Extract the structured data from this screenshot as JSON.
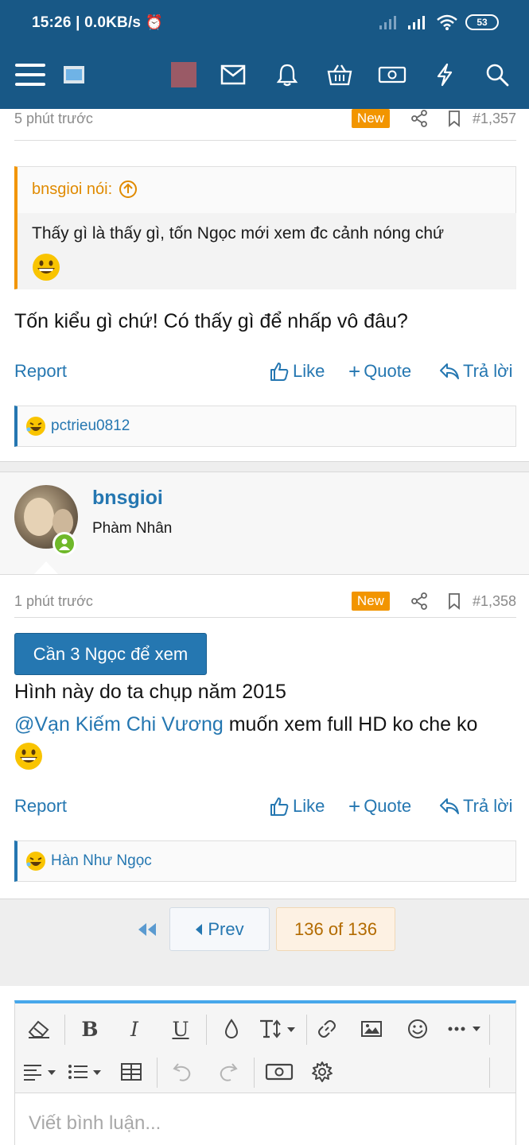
{
  "status_bar": {
    "time": "15:26",
    "network": "0.0KB/s",
    "battery": "53"
  },
  "colors": {
    "header_bg": "#185886",
    "accent": "#2577b1",
    "new_badge": "#f29500",
    "online": "#6fb82a"
  },
  "nav_icons": [
    "menu-icon",
    "logo-icon",
    "avatar-icon",
    "inbox-icon",
    "bell-icon",
    "basket-icon",
    "money-icon",
    "flash-icon",
    "search-icon"
  ],
  "post1": {
    "time": "5 phút trước",
    "badge": "New",
    "number": "#1,357",
    "quote_author": "bnsgioi nói:",
    "quote_text": "Thấy gì là thấy gì, tốn Ngọc mới xem đc cảnh nóng chứ",
    "body": "Tốn kiểu gì chứ! Có thấy gì để nhấp vô đâu?",
    "report": "Report",
    "like": "Like",
    "quote": "Quote",
    "reply": "Trả lời",
    "reaction_user": "pctrieu0812"
  },
  "post2": {
    "author": "bnsgioi",
    "author_title": "Phàm Nhân",
    "time": "1 phút trước",
    "badge": "New",
    "number": "#1,358",
    "unlock_button": "Cần 3 Ngọc để xem",
    "line1": "Hình này do ta chụp năm 2015",
    "mention": "@Vạn Kiếm Chi Vương",
    "line2_rest": " muốn xem full HD ko che ko",
    "report": "Report",
    "like": "Like",
    "quote": "Quote",
    "reply": "Trả lời",
    "reaction_user": "Hàn Như Ngọc"
  },
  "pagination": {
    "prev": "Prev",
    "current": "136 of 136"
  },
  "editor": {
    "placeholder": "Viết bình luận...",
    "bold": "B",
    "italic": "I",
    "underline": "U"
  }
}
